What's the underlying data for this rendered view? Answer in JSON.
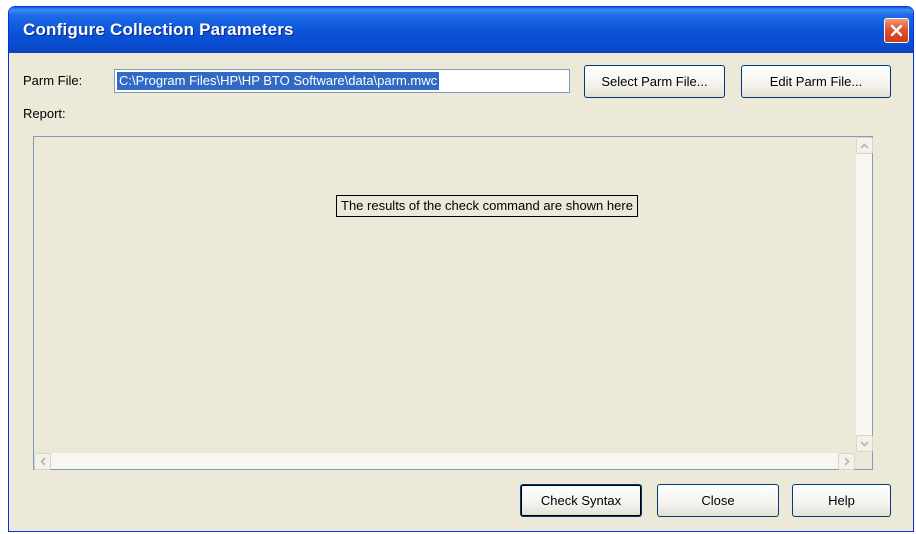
{
  "window": {
    "title": "Configure Collection Parameters"
  },
  "parm_file": {
    "label": "Parm File:",
    "value": "C:\\Program Files\\HP\\HP BTO Software\\data\\parm.mwc"
  },
  "buttons": {
    "select_parm": "Select Parm File...",
    "edit_parm": "Edit Parm File...",
    "check_syntax": "Check Syntax",
    "close": "Close",
    "help": "Help"
  },
  "report": {
    "label": "Report:",
    "placeholder_text": "The results of the check command are shown here"
  },
  "colors": {
    "titlebar": "#0a4ccf",
    "dialog_bg": "#ece9d8",
    "selection": "#316ac5",
    "close_button": "#e0542e"
  },
  "icons": [
    "close-icon",
    "scroll-up-arrow-icon",
    "scroll-down-arrow-icon",
    "scroll-left-arrow-icon",
    "scroll-right-arrow-icon"
  ]
}
